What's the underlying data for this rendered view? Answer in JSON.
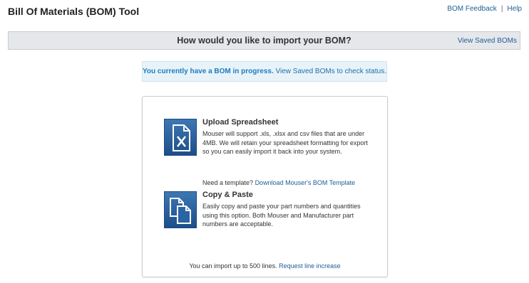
{
  "page": {
    "title": "Bill Of Materials (BOM) Tool"
  },
  "top_links": {
    "feedback": "BOM Feedback",
    "separator": "|",
    "help": "Help"
  },
  "header_bar": {
    "question": "How would you like to import your BOM?",
    "saved_link": "View Saved BOMs"
  },
  "notice": {
    "strong": "You currently have a BOM in progress.",
    "link": "View Saved BOMs to check status."
  },
  "options": [
    {
      "icon": "excel-file-icon",
      "title": "Upload Spreadsheet",
      "description": "Mouser will support .xls, .xlsx and csv files that are under 4MB. We will retain your spreadsheet formatting for export so you can easily import it back into your system.",
      "template_prefix": "Need a template?",
      "template_link": "Download Mouser's BOM Template"
    },
    {
      "icon": "copy-paste-icon",
      "title": "Copy & Paste",
      "description": "Easily copy and paste your part numbers and quantities using this option. Both Mouser and Manufacturer part numbers are acceptable."
    }
  ],
  "footer": {
    "text": "You can import up to 500 lines.",
    "link": "Request line increase"
  },
  "colors": {
    "link": "#1f5c99",
    "tile": "#2a64a3",
    "notice_bg": "#e8f3f9"
  }
}
